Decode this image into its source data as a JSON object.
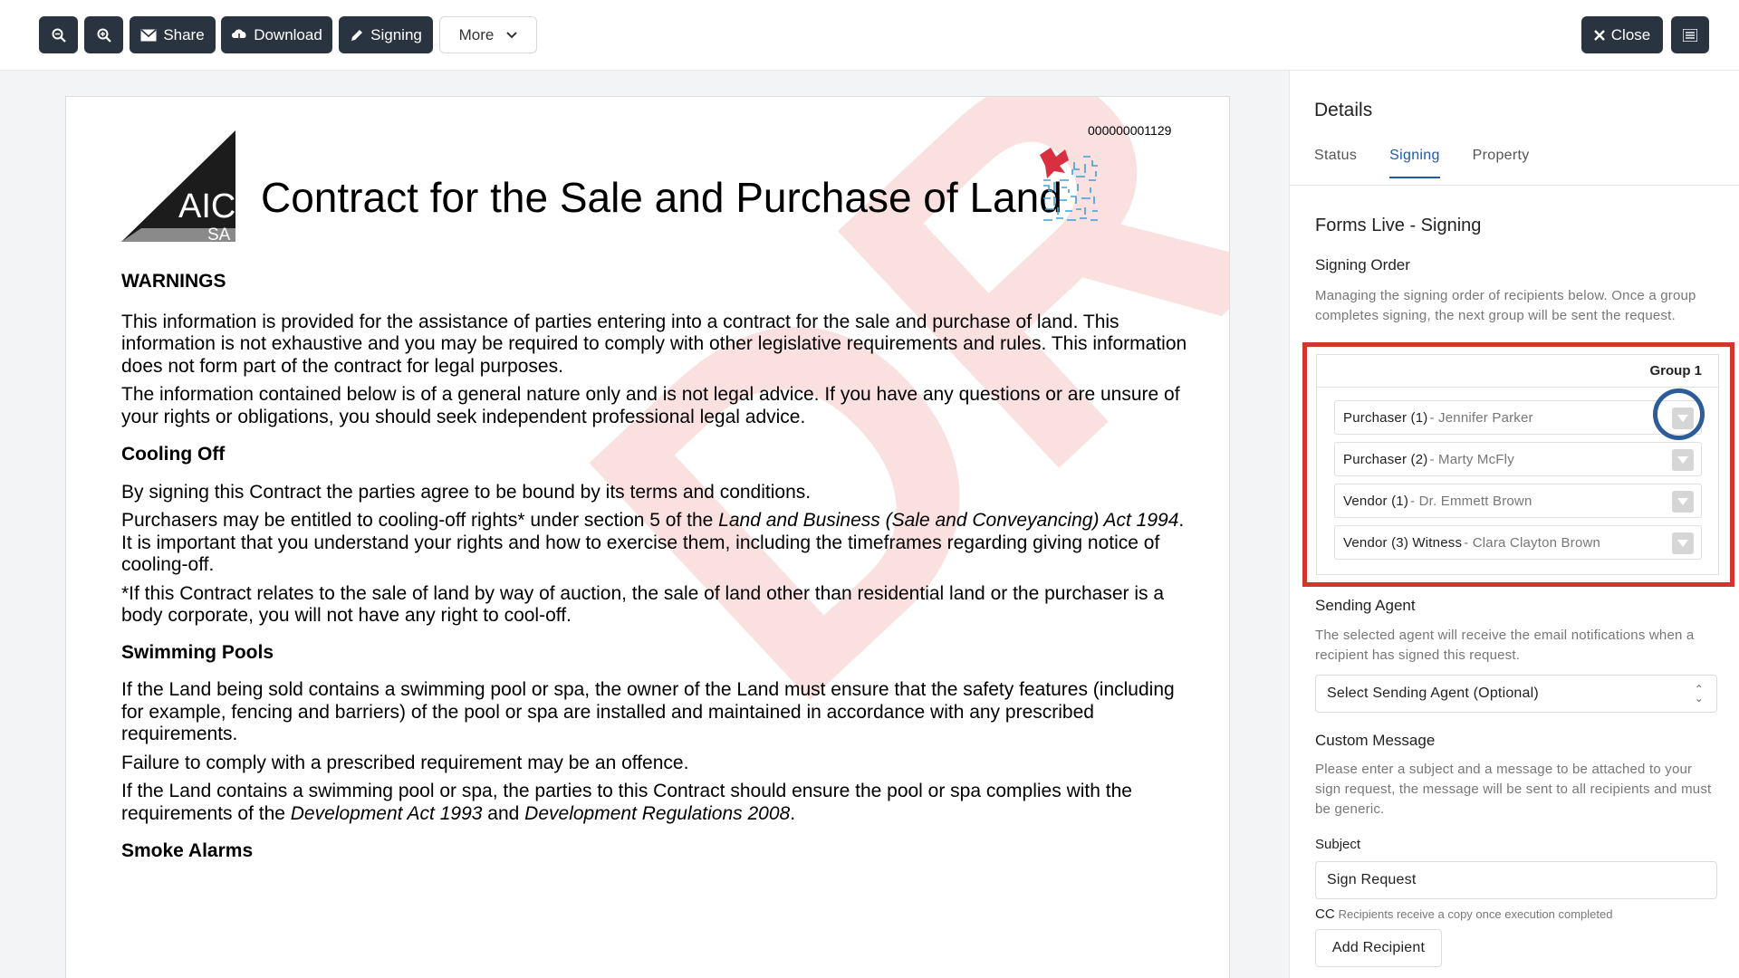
{
  "toolbar": {
    "zoom_out_icon": "zoom-out-icon",
    "zoom_in_icon": "zoom-in-icon",
    "share_label": "Share",
    "download_label": "Download",
    "signing_label": "Signing",
    "more_label": "More",
    "close_label": "Close",
    "list_icon": "list-icon"
  },
  "document": {
    "doc_id": "000000001129",
    "logo_main": "AIC",
    "logo_sub": "SA",
    "title": "Contract for the Sale and Purchase of Land",
    "watermark": "DRAFT",
    "warnings_heading": "WARNINGS",
    "warnings_p1": "This information is provided for the assistance of parties entering into a contract for the sale and purchase of land. This information is not exhaustive and you may be required to comply with other legislative requirements and rules. This information does not form part of the contract for legal purposes.",
    "warnings_p2": "The information contained below is of a general nature only and is not legal advice.  If you have any questions or are unsure of your rights or obligations, you should seek independent professional legal advice.",
    "cooling_heading": "Cooling Off",
    "cooling_p1": "By signing this Contract the parties agree to be bound by its terms and conditions.",
    "cooling_p2_a": "Purchasers may be entitled to cooling-off rights* under section 5 of the ",
    "cooling_p2_italic": "Land and Business (Sale and Conveyancing) Act 1994",
    "cooling_p2_b": ". It is important that you understand your rights and how to exercise them, including the timeframes regarding giving notice of cooling-off.",
    "cooling_p3": "*If this Contract relates to the sale of land by way of auction, the sale of land other than residential land or the purchaser is a body corporate, you will not have any right to cool-off.",
    "pools_heading": "Swimming Pools",
    "pools_p1": "If the Land being sold contains a swimming pool or spa, the owner of the Land must ensure that the safety features (including for example, fencing and barriers) of the pool or spa are installed and maintained in accordance with any prescribed requirements.",
    "pools_p2": "Failure to comply with a prescribed requirement may be an offence.",
    "pools_p3_a": "If the Land contains a swimming pool or spa, the parties to this Contract should ensure the pool or spa complies with the requirements of the ",
    "pools_p3_i1": "Development Act 1993",
    "pools_p3_b": " and ",
    "pools_p3_i2": "Development Regulations 2008",
    "pools_p3_c": ".",
    "smoke_heading": "Smoke Alarms"
  },
  "sidebar": {
    "title": "Details",
    "tabs": [
      "Status",
      "Signing",
      "Property"
    ],
    "active_tab": "Signing",
    "section_title": "Forms Live - Signing",
    "signing_order_heading": "Signing Order",
    "signing_order_desc": "Managing the signing order of recipients below. Once a group completes signing, the next group will be sent the request.",
    "group_label": "Group 1",
    "recipients": [
      {
        "role": "Purchaser (1)",
        "name": "- Jennifer Parker"
      },
      {
        "role": "Purchaser (2)",
        "name": "- Marty McFly"
      },
      {
        "role": "Vendor (1)",
        "name": "- Dr. Emmett Brown"
      },
      {
        "role": "Vendor (3) Witness",
        "name": "- Clara Clayton Brown"
      }
    ],
    "sending_agent_heading": "Sending Agent",
    "sending_agent_desc": "The selected agent will receive the email notifications when a recipient has signed this request.",
    "sending_agent_select": "Select Sending Agent (Optional)",
    "custom_message_heading": "Custom Message",
    "custom_message_desc": "Please enter a subject and a message to be attached to your sign request, the message will be sent to all recipients and must be generic.",
    "subject_label": "Subject",
    "subject_value": "Sign Request",
    "cc_label": "CC",
    "cc_note": "Recipients receive a copy once execution completed",
    "add_recipient_label": "Add Recipient"
  },
  "colors": {
    "toolbar_button": "#2a3440",
    "accent": "#1f5aa8",
    "highlight_box": "#d0362b",
    "highlight_circle": "#2c5d99",
    "watermark": "#e64646"
  }
}
